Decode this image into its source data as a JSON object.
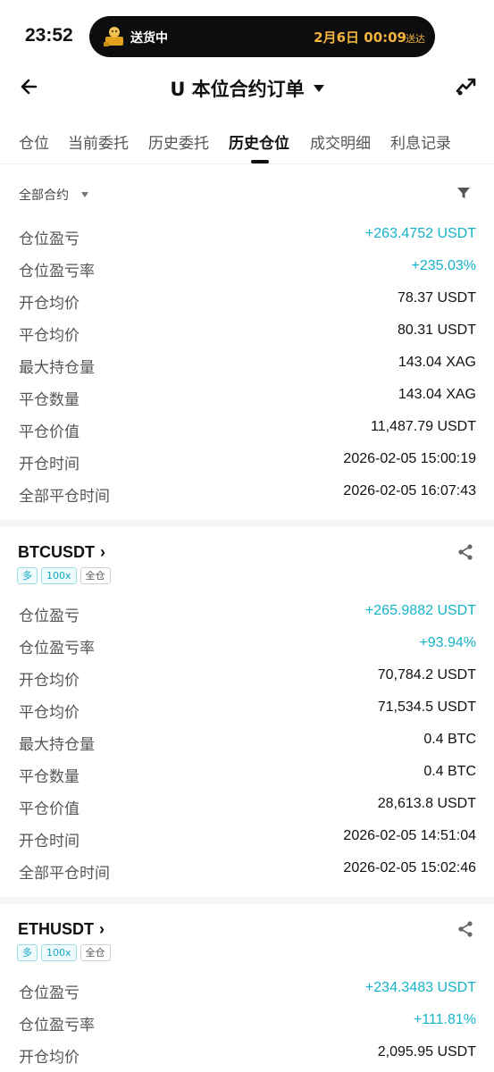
{
  "status_bar": {
    "time": "23:52",
    "delivery_status": "送货中",
    "delivery_date": "2月6日 00:09",
    "delivery_suffix": "送达",
    "accent_color": "#f2b43c"
  },
  "header": {
    "title": "U 本位合约订单",
    "back_icon": "arrow-left-icon",
    "right_icon": "share-chart-icon"
  },
  "tabs": [
    {
      "label": "仓位",
      "active": false
    },
    {
      "label": "当前委托",
      "active": false
    },
    {
      "label": "历史委托",
      "active": false
    },
    {
      "label": "历史仓位",
      "active": true
    },
    {
      "label": "成交明细",
      "active": false
    },
    {
      "label": "利息记录",
      "active": false
    }
  ],
  "filter": {
    "label": "全部合约",
    "icon": "funnel-icon"
  },
  "profit_color": "#14b3c9",
  "positions": [
    {
      "rows": [
        {
          "label": "仓位盈亏",
          "value": "+263.4752 USDT"
        },
        {
          "label": "仓位盈亏率",
          "value": "+235.03%"
        },
        {
          "label": "开仓均价",
          "value": "78.37 USDT"
        },
        {
          "label": "平仓均价",
          "value": "80.31 USDT"
        },
        {
          "label": "最大持仓量",
          "value": "143.04 XAG"
        },
        {
          "label": "平仓数量",
          "value": "143.04 XAG"
        },
        {
          "label": "平仓价值",
          "value": "11,487.79 USDT"
        },
        {
          "label": "开仓时间",
          "value": "2026-02-05 15:00:19"
        },
        {
          "label": "全部平仓时间",
          "value": "2026-02-05 16:07:43"
        }
      ]
    },
    {
      "symbol": "BTCUSDT",
      "chevron": "›",
      "tags": {
        "side": "多",
        "leverage": "100x",
        "margin": "全仓"
      },
      "rows": [
        {
          "label": "仓位盈亏",
          "value": "+265.9882 USDT"
        },
        {
          "label": "仓位盈亏率",
          "value": "+93.94%"
        },
        {
          "label": "开仓均价",
          "value": "70,784.2 USDT"
        },
        {
          "label": "平仓均价",
          "value": "71,534.5 USDT"
        },
        {
          "label": "最大持仓量",
          "value": "0.4 BTC"
        },
        {
          "label": "平仓数量",
          "value": "0.4 BTC"
        },
        {
          "label": "平仓价值",
          "value": "28,613.8 USDT"
        },
        {
          "label": "开仓时间",
          "value": "2026-02-05 14:51:04"
        },
        {
          "label": "全部平仓时间",
          "value": "2026-02-05 15:02:46"
        }
      ]
    },
    {
      "symbol": "ETHUSDT",
      "chevron": "›",
      "tags": {
        "side": "多",
        "leverage": "100x",
        "margin": "全仓"
      },
      "rows": [
        {
          "label": "仓位盈亏",
          "value": "+234.3483 USDT"
        },
        {
          "label": "仓位盈亏率",
          "value": "+111.81%"
        },
        {
          "label": "开仓均价",
          "value": "2,095.95 USDT"
        }
      ]
    }
  ]
}
